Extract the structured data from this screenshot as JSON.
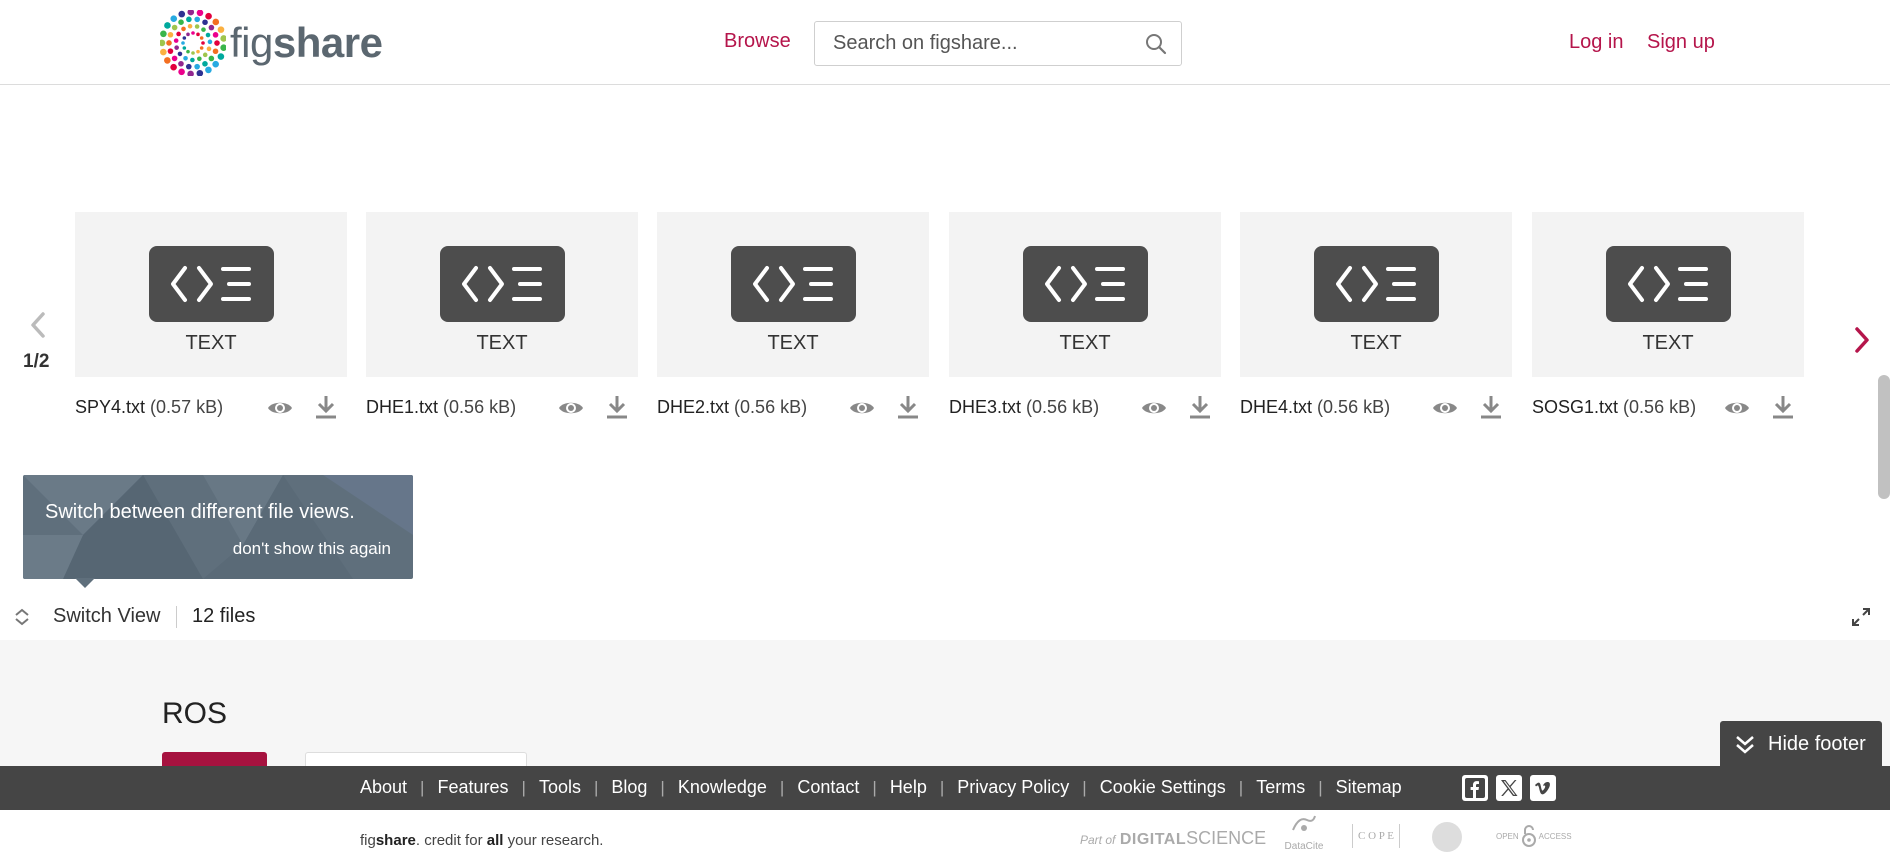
{
  "header": {
    "logo_text_light": "fig",
    "logo_text_bold": "share",
    "browse_label": "Browse",
    "search_placeholder": "Search on figshare...",
    "login_label": "Log in",
    "signup_label": "Sign up"
  },
  "carousel": {
    "page_indicator": "1/2",
    "files": [
      {
        "type": "TEXT",
        "name": "SPY4.txt",
        "size": "(0.57 kB)"
      },
      {
        "type": "TEXT",
        "name": "DHE1.txt",
        "size": "(0.56 kB)"
      },
      {
        "type": "TEXT",
        "name": "DHE2.txt",
        "size": "(0.56 kB)"
      },
      {
        "type": "TEXT",
        "name": "DHE3.txt",
        "size": "(0.56 kB)"
      },
      {
        "type": "TEXT",
        "name": "DHE4.txt",
        "size": "(0.56 kB)"
      },
      {
        "type": "TEXT",
        "name": "SOSG1.txt",
        "size": "(0.56 kB)"
      }
    ]
  },
  "tooltip": {
    "message": "Switch between different file views.",
    "dismiss_label": "don't show this again"
  },
  "file_toolbar": {
    "switch_view_label": "Switch View",
    "files_count": "12 files"
  },
  "item": {
    "title": "ROS"
  },
  "hide_footer_label": "Hide footer",
  "footer": {
    "links": [
      "About",
      "Features",
      "Tools",
      "Blog",
      "Knowledge",
      "Contact",
      "Help",
      "Privacy Policy",
      "Cookie Settings",
      "Terms",
      "Sitemap"
    ],
    "tagline_brand_light": "fig",
    "tagline_brand_bold": "share",
    "tagline_rest_1": ". credit for ",
    "tagline_bold_word": "all",
    "tagline_rest_2": " your research.",
    "partners": {
      "digital_science_prefix": "Part of",
      "digital_science_bold": "DIGITAL",
      "digital_science_light": "SCIENCE",
      "datacite": "DataCite",
      "cope": "C O P E",
      "open_access_light": "OPEN",
      "open_access_bold": "ACCESS"
    },
    "social_icons": [
      "facebook-icon",
      "x-icon",
      "vimeo-icon"
    ]
  },
  "colors": {
    "brand": "#b5154b",
    "footer_bg": "#454545",
    "tooltip_bg": "#5f6f7c",
    "tile_bg": "#f3f3f3"
  }
}
